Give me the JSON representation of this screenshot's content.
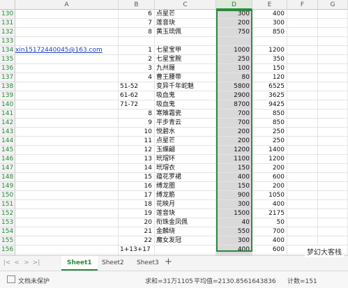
{
  "columns": [
    "A",
    "B",
    "C",
    "D",
    "E",
    "F",
    "G"
  ],
  "rows": [
    {
      "n": "130",
      "a": "",
      "b": "6",
      "c": "点星芒",
      "d": "300",
      "e": "400"
    },
    {
      "n": "131",
      "a": "",
      "b": "7",
      "c": "莲音玦",
      "d": "200",
      "e": "300"
    },
    {
      "n": "132",
      "a": "",
      "b": "8",
      "c": "黄玉琉佩",
      "d": "750",
      "e": "850"
    },
    {
      "n": "133",
      "a": "",
      "b": "",
      "c": "",
      "d": "",
      "e": ""
    },
    {
      "n": "134",
      "a": "xin15172440045@163.com",
      "b": "1",
      "c": "七星宝甲",
      "d": "1000",
      "e": "1200"
    },
    {
      "n": "135",
      "a": "",
      "b": "2",
      "c": "七星宝腕",
      "d": "250",
      "e": "350"
    },
    {
      "n": "136",
      "a": "",
      "b": "3",
      "c": "九州履",
      "d": "100",
      "e": "150"
    },
    {
      "n": "137",
      "a": "",
      "b": "4",
      "c": "曹王腰带",
      "d": "80",
      "e": "120"
    },
    {
      "n": "138",
      "a": "",
      "b": "51-52",
      "c": "变异千年蛇魅",
      "d": "5800",
      "e": "6525"
    },
    {
      "n": "139",
      "a": "",
      "b": "61-62",
      "c": "吸血鬼",
      "d": "2900",
      "e": "3625"
    },
    {
      "n": "140",
      "a": "",
      "b": "71-72",
      "c": "吸血鬼",
      "d": "8700",
      "e": "9425"
    },
    {
      "n": "141",
      "a": "",
      "b": "8",
      "c": "寒雉霜瓷",
      "d": "700",
      "e": "850"
    },
    {
      "n": "142",
      "a": "",
      "b": "9",
      "c": "平步青云",
      "d": "700",
      "e": "850"
    },
    {
      "n": "143",
      "a": "",
      "b": "10",
      "c": "悦碧水",
      "d": "200",
      "e": "250"
    },
    {
      "n": "144",
      "a": "",
      "b": "11",
      "c": "点星芒",
      "d": "200",
      "e": "250"
    },
    {
      "n": "145",
      "a": "",
      "b": "12",
      "c": "玉蝶翩",
      "d": "1200",
      "e": "1400"
    },
    {
      "n": "146",
      "a": "",
      "b": "13",
      "c": "玳瑁环",
      "d": "1100",
      "e": "1200"
    },
    {
      "n": "147",
      "a": "",
      "b": "14",
      "c": "玳瑁衣",
      "d": "150",
      "e": "200"
    },
    {
      "n": "148",
      "a": "",
      "b": "15",
      "c": "蕴花罗裙",
      "d": "400",
      "e": "600"
    },
    {
      "n": "149",
      "a": "",
      "b": "16",
      "c": "缚龙圈",
      "d": "150",
      "e": "200"
    },
    {
      "n": "150",
      "a": "",
      "b": "17",
      "c": "缚龙筋",
      "d": "900",
      "e": "1050"
    },
    {
      "n": "151",
      "a": "",
      "b": "18",
      "c": "花映月",
      "d": "300",
      "e": "400"
    },
    {
      "n": "152",
      "a": "",
      "b": "19",
      "c": "莲音玦",
      "d": "1500",
      "e": "2175"
    },
    {
      "n": "153",
      "a": "",
      "b": "20",
      "c": "衔珠金凤佩",
      "d": "40",
      "e": "50"
    },
    {
      "n": "154",
      "a": "",
      "b": "21",
      "c": "金麟绕",
      "d": "550",
      "e": "700"
    },
    {
      "n": "155",
      "a": "",
      "b": "22",
      "c": "魔女发冠",
      "d": "300",
      "e": "400"
    },
    {
      "n": "156",
      "a": "",
      "b": "1+13+17",
      "c": "",
      "d": "400",
      "e": "600"
    },
    {
      "n": "157",
      "a": "",
      "b": "",
      "c": "",
      "d": "",
      "e": ""
    }
  ],
  "tabs": [
    "Sheet1",
    "Sheet2",
    "Sheet3"
  ],
  "active_tab": "Sheet1",
  "add_tab": "+",
  "nav": [
    "|<",
    "<",
    ">",
    ">|"
  ],
  "status": {
    "protect": "文档未保护",
    "sum": "求和=31万1105",
    "avg": "平均值=2130.8561643836",
    "count": "计数=151"
  },
  "watermark": "梦幻大客栈",
  "colors": {
    "accent": "#2a8a3c",
    "selection": "#d9d9d9",
    "link": "#1f3fbf"
  }
}
